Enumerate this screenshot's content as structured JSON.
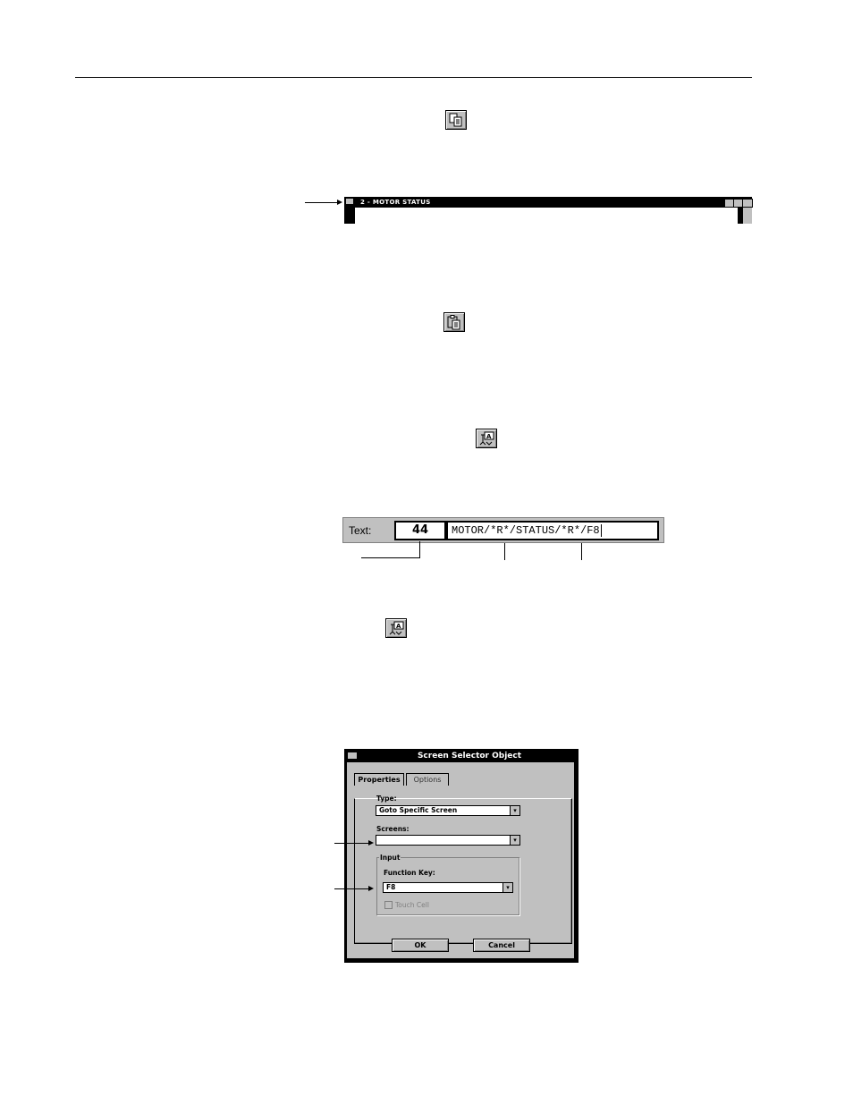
{
  "window_strip": {
    "title": "2 - MOTOR STATUS"
  },
  "text_bar": {
    "label": "Text:",
    "number": "44",
    "value": "MOTOR/*R*/STATUS/*R*/F8"
  },
  "dialog": {
    "title": "Screen Selector Object",
    "tabs": [
      "Properties",
      "Options"
    ],
    "type_label": "Type:",
    "type_value": "Goto Specific Screen",
    "screens_label": "Screens:",
    "screens_value": "",
    "input_group_label": "Input",
    "function_key_label": "Function Key:",
    "function_key_value": "F8",
    "touch_cell_label": "Touch Cell",
    "ok_label": "OK",
    "cancel_label": "Cancel"
  },
  "icons": [
    "copy-icon",
    "paste-icon",
    "screen-selector-icon"
  ]
}
